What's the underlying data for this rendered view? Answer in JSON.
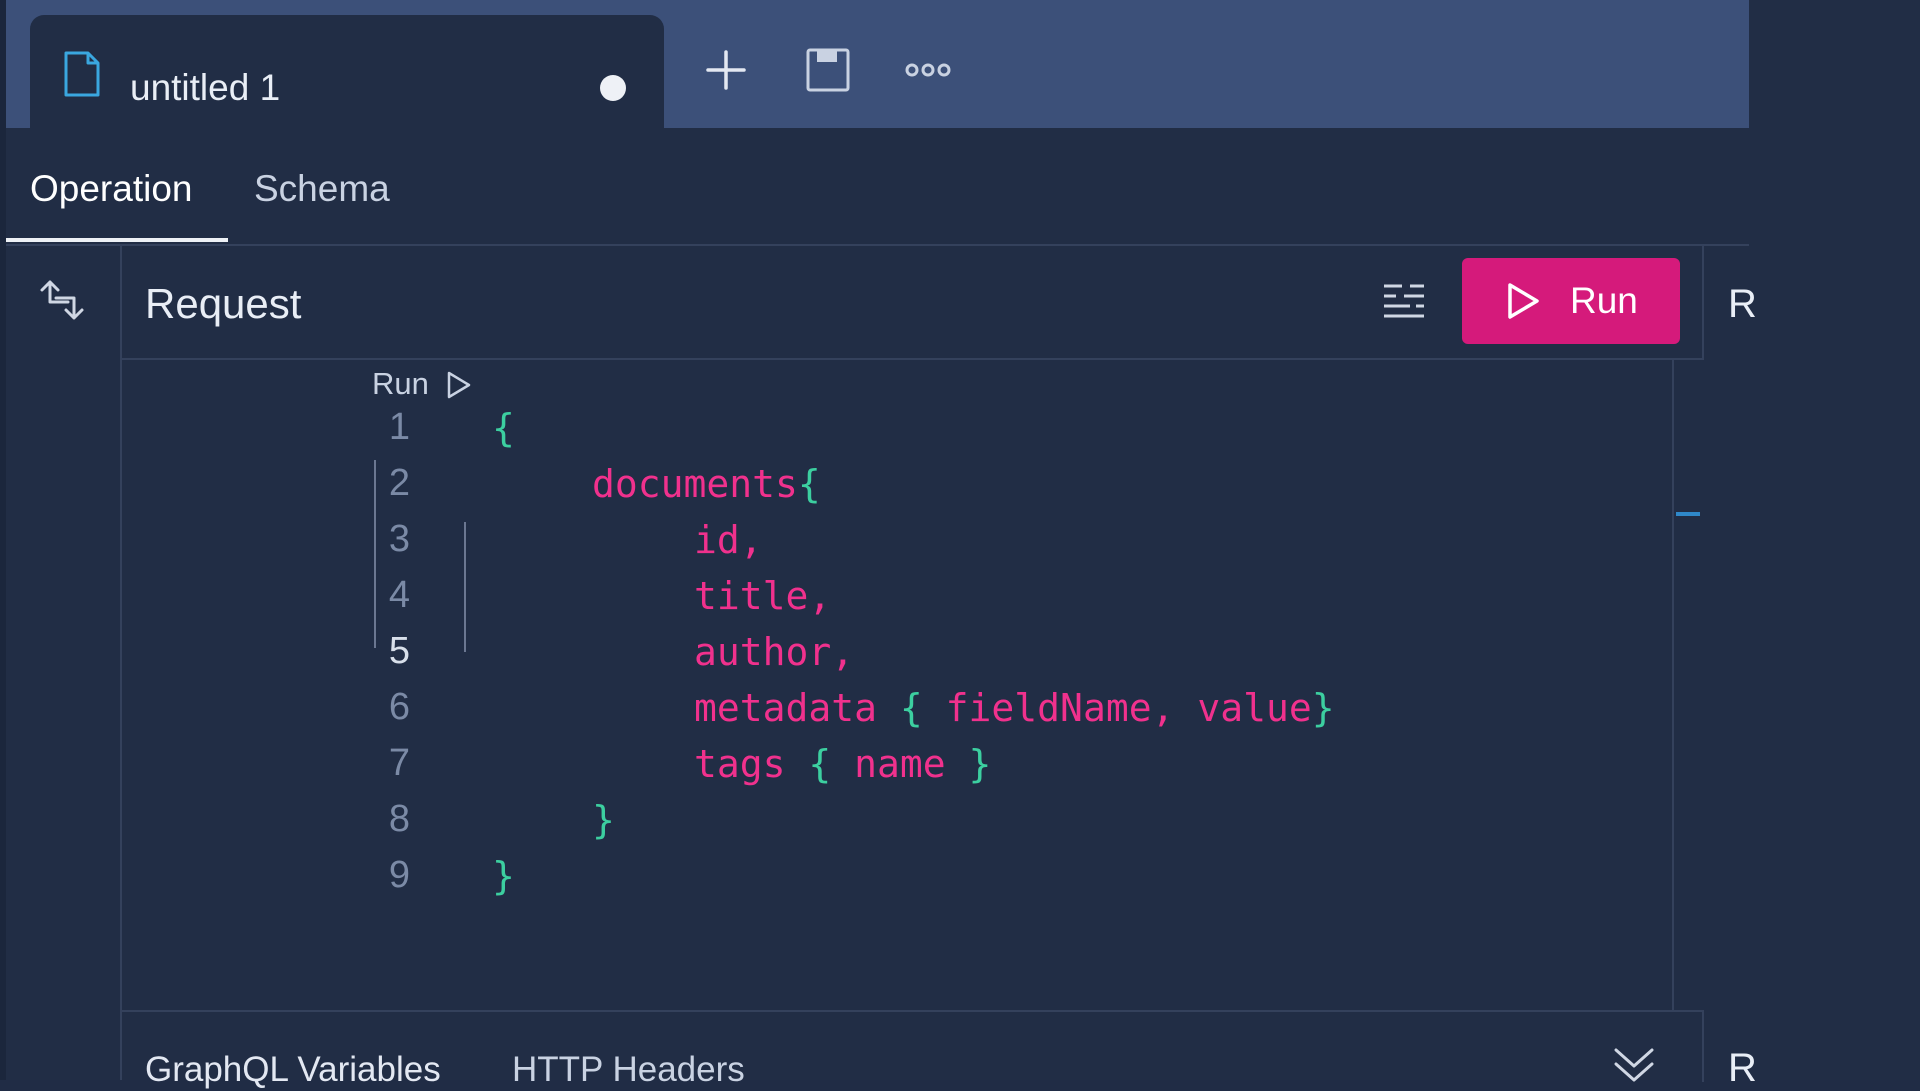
{
  "tabbar": {
    "tab_title": "untitled 1",
    "icons": [
      "file-icon",
      "unsaved-dot",
      "plus-icon",
      "save-icon",
      "more-icon"
    ]
  },
  "subtabs": [
    "Operation",
    "Schema"
  ],
  "request": {
    "title": "Request",
    "run_label": "Run",
    "codelens_label": "Run"
  },
  "editor": {
    "lines": [
      {
        "num": "1",
        "text": "{"
      },
      {
        "num": "2",
        "text": "documents{"
      },
      {
        "num": "3",
        "text": "id,"
      },
      {
        "num": "4",
        "text": "title,"
      },
      {
        "num": "5",
        "text": "author,"
      },
      {
        "num": "6",
        "text": "metadata { fieldName, value}"
      },
      {
        "num": "7",
        "text": "tags { name }"
      },
      {
        "num": "8",
        "text": "}"
      },
      {
        "num": "9",
        "text": "}"
      }
    ],
    "current_line": 5
  },
  "bottom_tabs": [
    "GraphQL Variables",
    "HTTP Headers"
  ],
  "response_peek": "R",
  "colors": {
    "accent": "#d51a7b",
    "keyword": "#f0318d",
    "punctuation": "#3ccfa0",
    "background": "#212d45",
    "tabbar": "#3c5079"
  }
}
